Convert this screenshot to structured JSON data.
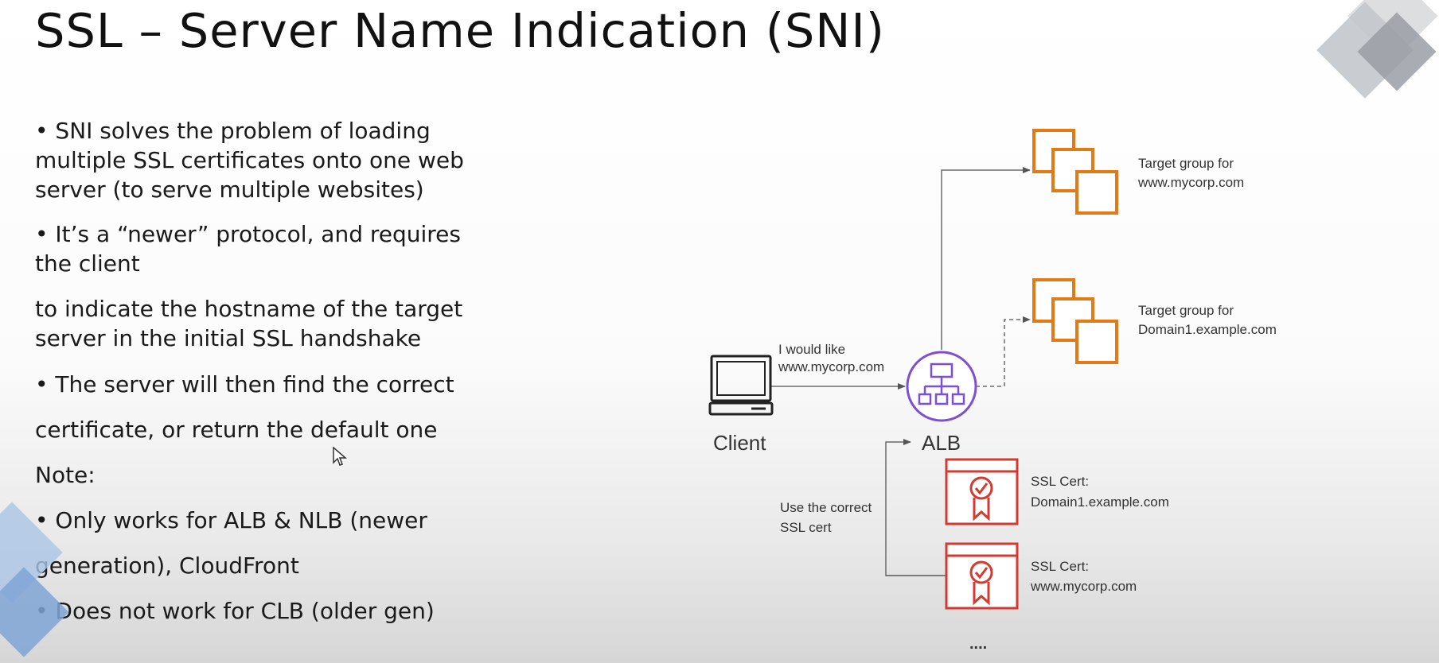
{
  "slide": {
    "title": "SSL – Server Name Indication (SNI)",
    "bullets": [
      "• SNI solves the problem of loading",
      "multiple SSL certificates onto one web",
      "server (to serve multiple websites)",
      "• It’s a “newer” protocol, and requires",
      "the client",
      "to indicate the hostname of the target",
      "server in the initial SSL handshake",
      "• The server will then find the correct",
      "certificate, or return the default one",
      "Note:",
      "• Only works for ALB & NLB (newer",
      "generation), CloudFront",
      "• Does not work for CLB (older gen)"
    ]
  },
  "diagram": {
    "client_label": "Client",
    "request_label": [
      "I would like",
      "www.mycorp.com"
    ],
    "alb_label": "ALB",
    "target_group_1": [
      "Target group for",
      "www.mycorp.com"
    ],
    "target_group_2": [
      "Target group for",
      "Domain1.example.com"
    ],
    "use_cert_label": [
      "Use the correct",
      "SSL cert"
    ],
    "cert_1": [
      "SSL Cert:",
      "Domain1.example.com"
    ],
    "cert_2": [
      "SSL Cert:",
      "www.mycorp.com"
    ],
    "more_label": "....",
    "colors": {
      "target_group": "#e07b18",
      "alb": "#7b4fd6",
      "cert": "#d23a32",
      "arrow": "#6b6b6b"
    },
    "icons": [
      "laptop-icon",
      "load-balancer-icon",
      "target-group-icon",
      "certificate-icon"
    ]
  }
}
